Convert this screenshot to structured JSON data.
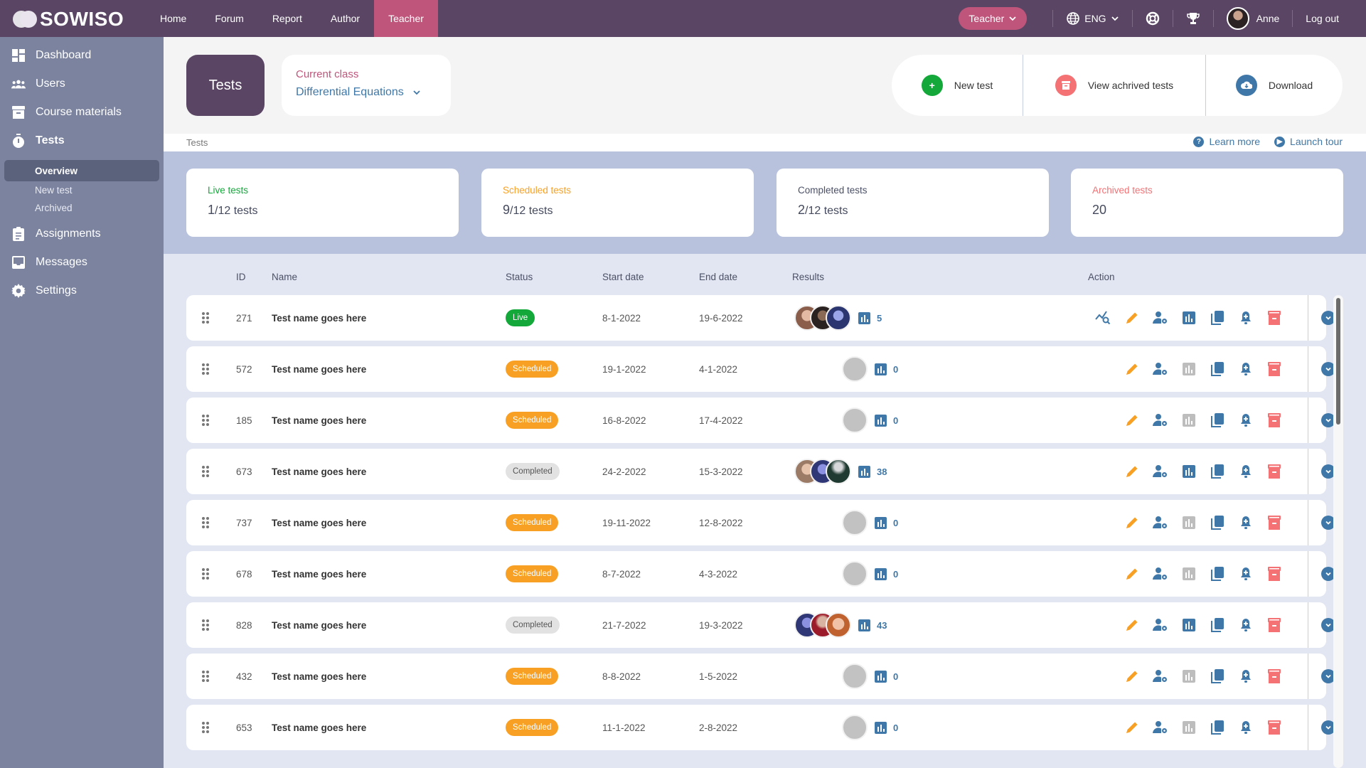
{
  "header": {
    "brand": "SOWISO",
    "nav": [
      {
        "label": "Home",
        "active": false
      },
      {
        "label": "Forum",
        "active": false
      },
      {
        "label": "Report",
        "active": false
      },
      {
        "label": "Author",
        "active": false
      },
      {
        "label": "Teacher",
        "active": true
      }
    ],
    "role_button": "Teacher",
    "language": "ENG",
    "user_name": "Anne",
    "logout": "Log out",
    "colors": {
      "bar": "#5a4664",
      "accent": "#c0557b"
    }
  },
  "sidebar": {
    "items": [
      {
        "label": "Dashboard",
        "icon": "dashboard-icon"
      },
      {
        "label": "Users",
        "icon": "users-icon"
      },
      {
        "label": "Course materials",
        "icon": "archive-box-icon"
      },
      {
        "label": "Tests",
        "icon": "stopwatch-icon",
        "active": true
      }
    ],
    "subitems": [
      {
        "label": "Overview",
        "active": true
      },
      {
        "label": "New test",
        "active": false
      },
      {
        "label": "Archived",
        "active": false
      }
    ],
    "items_after": [
      {
        "label": "Assignments",
        "icon": "clipboard-icon"
      },
      {
        "label": "Messages",
        "icon": "inbox-icon"
      },
      {
        "label": "Settings",
        "icon": "gear-icon"
      }
    ]
  },
  "page": {
    "title": "Tests",
    "current_class_label": "Current class",
    "current_class_value": "Differential Equations",
    "actions": [
      {
        "label": "New test",
        "icon": "plus-icon",
        "color": "#14a83b"
      },
      {
        "label": "View achrived tests",
        "icon": "archive-icon",
        "color": "#f47174"
      },
      {
        "label": "Download",
        "icon": "cloud-download-icon",
        "color": "#3f78a8"
      }
    ],
    "breadcrumb": "Tests",
    "learn_more": "Learn more",
    "launch_tour": "Launch tour"
  },
  "stats": [
    {
      "label": "Live tests",
      "value": "1",
      "suffix": "/12 tests",
      "color": "#14a83b"
    },
    {
      "label": "Scheduled tests",
      "value": "9",
      "suffix": "/12 tests",
      "color": "#f8a024"
    },
    {
      "label": "Completed tests",
      "value": "2",
      "suffix": "/12 tests",
      "color": "#4b5066"
    },
    {
      "label": "Archived tests",
      "value": "20",
      "suffix": "",
      "color": "#f47174"
    }
  ],
  "table": {
    "columns": [
      "ID",
      "Name",
      "Status",
      "Start date",
      "End date",
      "Results",
      "Action"
    ],
    "rows": [
      {
        "id": "271",
        "name": "Test name goes here",
        "status": "Live",
        "start": "8-1-2022",
        "end": "19-6-2022",
        "avatars": 3,
        "results": "5",
        "analyze": true,
        "stats_enabled": true
      },
      {
        "id": "572",
        "name": "Test name goes here",
        "status": "Scheduled",
        "start": "19-1-2022",
        "end": "4-1-2022",
        "avatars": 0,
        "results": "0",
        "analyze": false,
        "stats_enabled": false
      },
      {
        "id": "185",
        "name": "Test name goes here",
        "status": "Scheduled",
        "start": "16-8-2022",
        "end": "17-4-2022",
        "avatars": 0,
        "results": "0",
        "analyze": false,
        "stats_enabled": false
      },
      {
        "id": "673",
        "name": "Test name goes here",
        "status": "Completed",
        "start": "24-2-2022",
        "end": "15-3-2022",
        "avatars": 3,
        "results": "38",
        "analyze": false,
        "stats_enabled": true
      },
      {
        "id": "737",
        "name": "Test name goes here",
        "status": "Scheduled",
        "start": "19-11-2022",
        "end": "12-8-2022",
        "avatars": 0,
        "results": "0",
        "analyze": false,
        "stats_enabled": false
      },
      {
        "id": "678",
        "name": "Test name goes here",
        "status": "Scheduled",
        "start": "8-7-2022",
        "end": "4-3-2022",
        "avatars": 0,
        "results": "0",
        "analyze": false,
        "stats_enabled": false
      },
      {
        "id": "828",
        "name": "Test name goes here",
        "status": "Completed",
        "start": "21-7-2022",
        "end": "19-3-2022",
        "avatars": 3,
        "results": "43",
        "analyze": false,
        "stats_enabled": true
      },
      {
        "id": "432",
        "name": "Test name goes here",
        "status": "Scheduled",
        "start": "8-8-2022",
        "end": "1-5-2022",
        "avatars": 0,
        "results": "0",
        "analyze": false,
        "stats_enabled": false
      },
      {
        "id": "653",
        "name": "Test name goes here",
        "status": "Scheduled",
        "start": "11-1-2022",
        "end": "2-8-2022",
        "avatars": 0,
        "results": "0",
        "analyze": false,
        "stats_enabled": false
      }
    ],
    "status_colors": {
      "Live": "#14a83b",
      "Scheduled": "#f8a024",
      "Completed": "#e2e2e2"
    }
  }
}
